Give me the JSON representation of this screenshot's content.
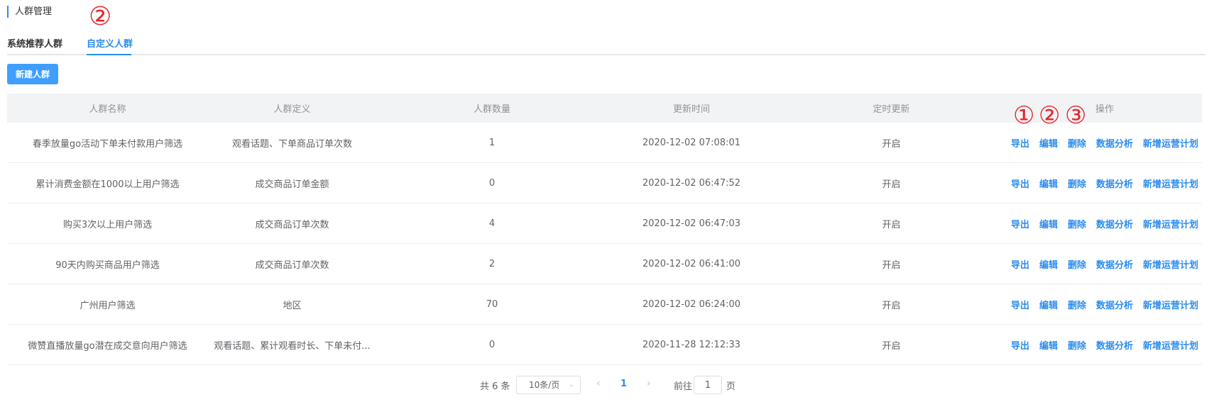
{
  "header": {
    "title": "人群管理"
  },
  "annotations": {
    "tab_mark": "②",
    "row_marks": [
      "①",
      "②",
      "③"
    ]
  },
  "tabs": [
    {
      "label": "系统推荐人群",
      "active": false
    },
    {
      "label": "自定义人群",
      "active": true
    }
  ],
  "toolbar": {
    "new_label": "新建人群"
  },
  "table": {
    "columns": [
      "人群名称",
      "人群定义",
      "人群数量",
      "更新时间",
      "定时更新",
      "操作"
    ],
    "actions": [
      "导出",
      "编辑",
      "删除",
      "数据分析",
      "新增运营计划"
    ],
    "rows": [
      {
        "name": "春季放量go活动下单未付款用户筛选",
        "definition": "观看话题、下单商品订单次数",
        "count": "1",
        "updated": "2020-12-02 07:08:01",
        "schedule": "开启"
      },
      {
        "name": "累计消费金额在1000以上用户筛选",
        "definition": "成交商品订单金额",
        "count": "0",
        "updated": "2020-12-02 06:47:52",
        "schedule": "开启"
      },
      {
        "name": "购买3次以上用户筛选",
        "definition": "成交商品订单次数",
        "count": "4",
        "updated": "2020-12-02 06:47:03",
        "schedule": "开启"
      },
      {
        "name": "90天内购买商品用户筛选",
        "definition": "成交商品订单次数",
        "count": "2",
        "updated": "2020-12-02 06:41:00",
        "schedule": "开启"
      },
      {
        "name": "广州用户筛选",
        "definition": "地区",
        "count": "70",
        "updated": "2020-12-02 06:24:00",
        "schedule": "开启"
      },
      {
        "name": "微赞直播放量go潜在成交意向用户筛选",
        "definition": "观看话题、累计观看时长、下单未付...",
        "count": "0",
        "updated": "2020-11-28 12:12:33",
        "schedule": "开启"
      }
    ]
  },
  "pagination": {
    "total_text": "共 6 条",
    "page_size": "10条/页",
    "current_page": "1",
    "goto_label": "前往",
    "goto_value": "1",
    "goto_suffix": "页"
  },
  "icons": {
    "chevron_down": "⌄",
    "prev": "‹",
    "next": "›"
  },
  "colors": {
    "accent": "#2b8cef",
    "annotation": "#e4262a",
    "header_bg": "#f2f3f5"
  }
}
